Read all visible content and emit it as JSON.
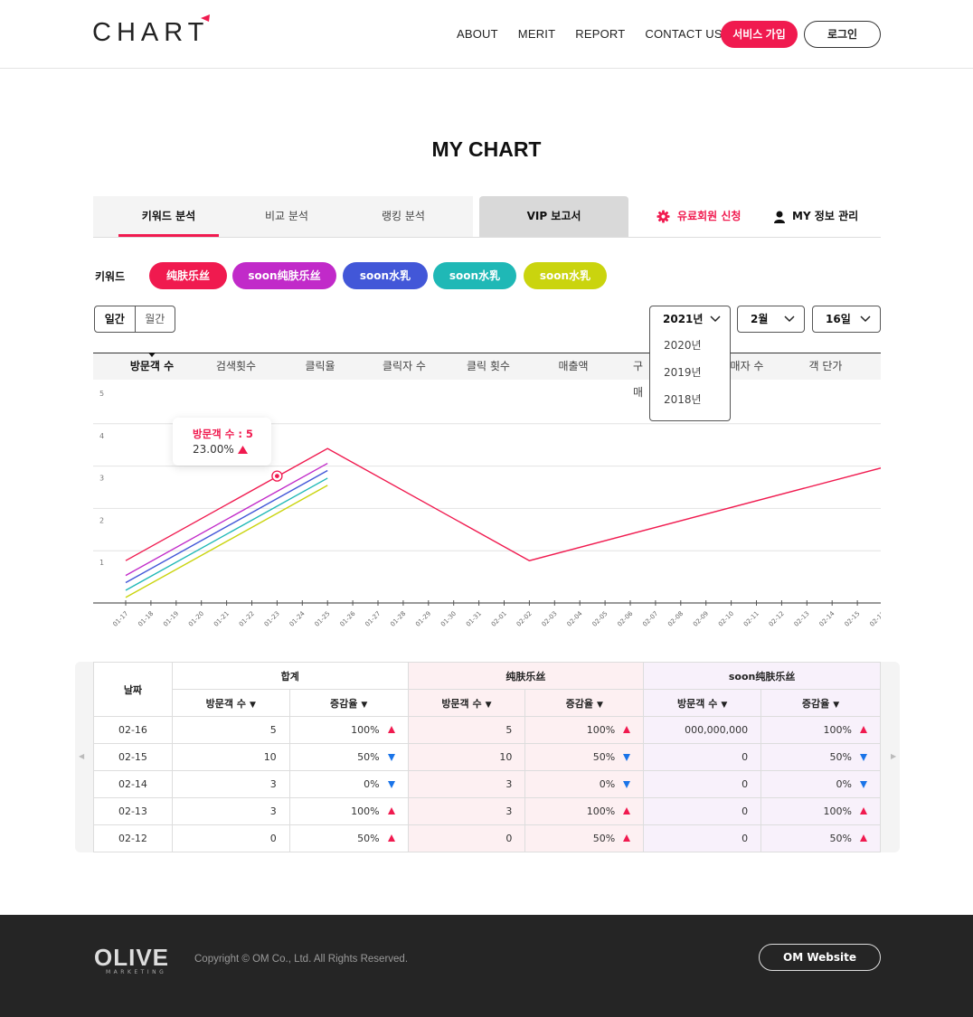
{
  "header": {
    "logo": "CHART",
    "nav": [
      "ABOUT",
      "MERIT",
      "REPORT",
      "CONTACT US"
    ],
    "join_label": "서비스 가입",
    "login_label": "로그인",
    "brand_color": "#f01a4f"
  },
  "page_title": "MY CHART",
  "tabs": {
    "items": [
      "키워드 분석",
      "비교 분석",
      "랭킹 분석"
    ],
    "vip": "VIP 보고서",
    "paid": "유료회원 신청",
    "my": "MY 정보 관리"
  },
  "keywords": {
    "label": "키워드",
    "items": [
      {
        "label": "纯肤乐丝",
        "color": "#f01a4f"
      },
      {
        "label": "soon纯肤乐丝",
        "color": "#c12ac9"
      },
      {
        "label": "soon水乳",
        "color": "#4257d8"
      },
      {
        "label": "soon水乳",
        "color": "#1fb8b6"
      },
      {
        "label": "soon水乳",
        "color": "#cad40e"
      }
    ]
  },
  "period": {
    "weekly": "일간",
    "monthly": "월간"
  },
  "selects": {
    "year": "2021년",
    "month": "2월",
    "day": "16일",
    "year_options": [
      "2020년",
      "2019년",
      "2018년"
    ]
  },
  "metrics": [
    "방문객 수",
    "검색횟수",
    "클릭율",
    "클릭자 수",
    "클릭 횟수",
    "매출액",
    "구매",
    "매자 수",
    "객 단가"
  ],
  "tooltip": {
    "title": "방문객 수 : 5",
    "value": "23.00%"
  },
  "chart_data": {
    "type": "line",
    "y_ticks": [
      "1",
      "2",
      "3",
      "4",
      "5"
    ],
    "ylim": [
      0,
      5
    ],
    "x": [
      "01-17",
      "01-18",
      "01-19",
      "01-20",
      "01-21",
      "01-22",
      "01-23",
      "01-24",
      "01-25",
      "01-26",
      "01-27",
      "01-28",
      "01-29",
      "01-30",
      "01-31",
      "02-01",
      "02-02",
      "02-03",
      "02-04",
      "02-05",
      "02-06",
      "02-07",
      "02-08",
      "02-09",
      "02-10",
      "02-11",
      "02-12",
      "02-13",
      "02-14",
      "02-15",
      "02-16"
    ],
    "series": [
      {
        "color": "#f01a4f",
        "points": [
          [
            0,
            1.0
          ],
          [
            8,
            3.65
          ],
          [
            16,
            1.0
          ],
          [
            30,
            3.2
          ]
        ]
      },
      {
        "color": "#c12ac9",
        "points": [
          [
            0,
            0.65
          ],
          [
            8,
            3.3
          ]
        ]
      },
      {
        "color": "#4257d8",
        "points": [
          [
            0,
            0.48
          ],
          [
            8,
            3.13
          ]
        ]
      },
      {
        "color": "#1fb8b6",
        "points": [
          [
            0,
            0.3
          ],
          [
            8,
            2.95
          ]
        ]
      },
      {
        "color": "#cad40e",
        "points": [
          [
            0,
            0.13
          ],
          [
            8,
            2.78
          ]
        ]
      }
    ],
    "highlight": {
      "x_index": 6,
      "y": 3.0
    }
  },
  "table": {
    "date_header": "날짜",
    "groups": [
      "합계",
      "纯肤乐丝",
      "soon纯肤乐丝"
    ],
    "sub_visitors": "방문객 수",
    "sub_rate": "증감율",
    "sort_glyph": "▼",
    "rows": [
      {
        "date": "02-16",
        "v1": "5",
        "r1": "100%",
        "t1": "up",
        "v2": "5",
        "r2": "100%",
        "t2": "up",
        "v3": "000,000,000",
        "r3": "100%",
        "t3": "up"
      },
      {
        "date": "02-15",
        "v1": "10",
        "r1": "50%",
        "t1": "down",
        "v2": "10",
        "r2": "50%",
        "t2": "down",
        "v3": "0",
        "r3": "50%",
        "t3": "down"
      },
      {
        "date": "02-14",
        "v1": "3",
        "r1": "0%",
        "t1": "down",
        "v2": "3",
        "r2": "0%",
        "t2": "down",
        "v3": "0",
        "r3": "0%",
        "t3": "down"
      },
      {
        "date": "02-13",
        "v1": "3",
        "r1": "100%",
        "t1": "up",
        "v2": "3",
        "r2": "100%",
        "t2": "up",
        "v3": "0",
        "r3": "100%",
        "t3": "up"
      },
      {
        "date": "02-12",
        "v1": "0",
        "r1": "50%",
        "t1": "up",
        "v2": "0",
        "r2": "50%",
        "t2": "up",
        "v3": "0",
        "r3": "50%",
        "t3": "up"
      }
    ]
  },
  "footer": {
    "logo": "OLIVE",
    "logo_sub": "MARKETING",
    "copyright": "Copyright © OM Co., Ltd. All Rights Reserved.",
    "website_btn": "OM Website"
  }
}
